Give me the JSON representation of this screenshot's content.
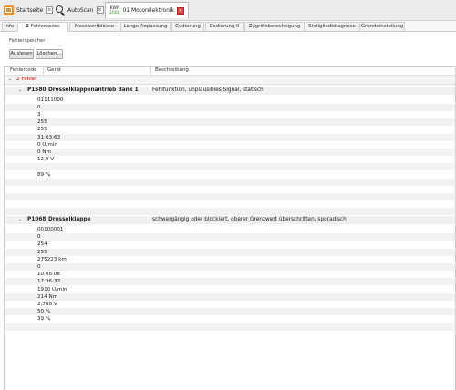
{
  "topbar": {
    "tabs": [
      {
        "label": "Startseite",
        "icon": "home-icon",
        "close": "×"
      },
      {
        "label": "AutoScan",
        "icon": "search-icon",
        "close": "×"
      },
      {
        "label": "01 Motorelektronik",
        "badge_top": "KWP",
        "badge_bottom": "2000",
        "close": "×"
      }
    ]
  },
  "tabbar": {
    "tabs": [
      "Info",
      "Fehlercodes",
      "Messwertblöcke",
      "Lange Anpassung",
      "Codierung",
      "Codierung II",
      "Zugriffsberechtigung",
      "Stellgliedtdiagnose",
      "Grundeinstellung"
    ],
    "active_badge": "2"
  },
  "section": {
    "title": "Fehlerspeicher"
  },
  "buttons": {
    "read": "Auslesen",
    "clear": "Löschen..."
  },
  "grid": {
    "headers": {
      "code": "Fehlercode",
      "device": "Gerät",
      "description": "Beschreibung"
    },
    "group_label": "2 Fehler",
    "faults": [
      {
        "code": "P1580",
        "name": "Drosselklappenantrieb Bank 1",
        "description": "Fehlfunktion, unplausibles Signal, statisch",
        "details": [
          "01111000",
          "0",
          "3",
          "255",
          "255",
          "31:63:63",
          "0 U/min",
          "0 Nm",
          "12,9 V",
          "",
          "89 %"
        ]
      },
      {
        "code": "P1068",
        "name": "Drosselklappe",
        "description": "schwergängig oder blockiert, oberer Grenzwert überschritten, sporadisch",
        "details": [
          "00100001",
          "0",
          "254",
          "255",
          "275223 km",
          "0",
          "10.08.08",
          "17:36:33",
          "1910 U/min",
          "214 Nm",
          "2,760 V",
          "50 %",
          "39 %"
        ]
      }
    ]
  }
}
